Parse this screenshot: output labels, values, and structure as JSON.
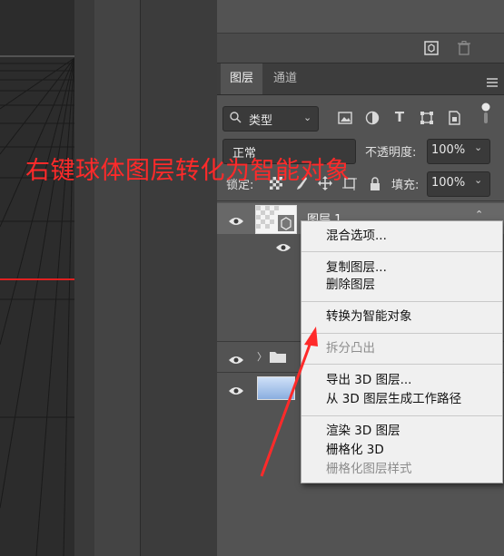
{
  "annotation": {
    "text": "右键球体图层转化为智能对象",
    "color": "#ff2a2a"
  },
  "panel": {
    "tabs": [
      {
        "label": "图层",
        "active": true
      },
      {
        "label": "通道",
        "active": false
      }
    ],
    "filter": {
      "label": "类型"
    },
    "blend_mode": "正常",
    "opacity": {
      "label": "不透明度:",
      "value": "100%"
    },
    "lock": {
      "label": "锁定:"
    },
    "fill": {
      "label": "填充:",
      "value": "100%"
    }
  },
  "layers": [
    {
      "name": "图层 1",
      "type": "3d",
      "visible": true,
      "selected": true
    },
    {
      "name": "",
      "type": "group",
      "visible": true
    },
    {
      "name": "",
      "type": "gradient",
      "visible": true
    }
  ],
  "context_menu": {
    "items": [
      {
        "label": "混合选项...",
        "enabled": true
      },
      {
        "label": "复制图层...",
        "enabled": true
      },
      {
        "label": "删除图层",
        "enabled": true
      },
      {
        "label": "转换为智能对象",
        "enabled": true
      },
      {
        "label": "拆分凸出",
        "enabled": false
      },
      {
        "label": "导出 3D 图层...",
        "enabled": true
      },
      {
        "label": "从 3D 图层生成工作路径",
        "enabled": true
      },
      {
        "label": "渲染 3D 图层",
        "enabled": true
      },
      {
        "label": "栅格化 3D",
        "enabled": true
      },
      {
        "label": "栅格化图层样式",
        "enabled": false
      }
    ]
  },
  "icons": {
    "panel_icons": [
      "new-3d-icon",
      "trash-icon",
      "panel-menu-icon"
    ],
    "filter_icons": [
      "image-filter-icon",
      "adjustment-filter-icon",
      "text-filter-icon",
      "shape-filter-icon",
      "smart-object-filter-icon",
      "toggle-dot-icon"
    ],
    "lock_icons": [
      "lock-transparent-icon",
      "lock-brush-icon",
      "lock-move-icon",
      "lock-artboard-icon",
      "lock-all-icon"
    ]
  }
}
